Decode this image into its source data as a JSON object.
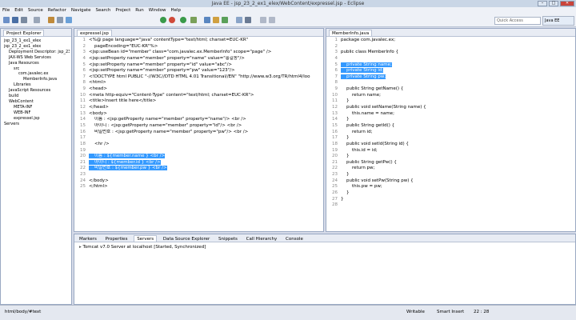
{
  "window": {
    "title": "Java EE - jsp_23_2_ex1_elex/WebContent/expressel.jsp - Eclipse"
  },
  "menu": [
    "File",
    "Edit",
    "Source",
    "Refactor",
    "Navigate",
    "Search",
    "Project",
    "Run",
    "Window",
    "Help"
  ],
  "toolbar": {
    "quick_access": "Quick Access",
    "perspective": "Java EE"
  },
  "project_explorer": {
    "tab": "Project Explorer",
    "items": [
      "jsp_23_1_ex1_elex",
      "jsp_23_2_ex1_elex",
      "Deployment Descriptor: jsp_23",
      "JAX-WS Web Services",
      "Java Resources",
      "src",
      "com.javalec.ex",
      "MemberInfo.java",
      "Libraries",
      "JavaScript Resources",
      "build",
      "WebContent",
      "META-INF",
      "WEB-INF",
      "expressel.jsp",
      "Servers"
    ]
  },
  "editor_left": {
    "tab": "expressel.jsp",
    "lines": [
      "<%@ page language=\"java\" contentType=\"text/html; charset=EUC-KR\"",
      "    pageEncoding=\"EUC-KR\"%>",
      "<jsp:useBean id=\"member\" class=\"com.javalec.ex.MemberInfo\" scope=\"page\" />",
      "<jsp:setProperty name=\"member\" property=\"name\" value=\"홍길동\"/>",
      "<jsp:setProperty name=\"member\" property=\"id\" value=\"abc\"/>",
      "<jsp:setProperty name=\"member\" property=\"pw\" value=\"123\"/>",
      "<!DOCTYPE html PUBLIC \"-//W3C//DTD HTML 4.01 Transitional//EN\" \"http://www.w3.org/TR/html4/loo",
      "<html>",
      "<head>",
      "<meta http-equiv=\"Content-Type\" content=\"text/html; charset=EUC-KR\">",
      "<title>Insert title here</title>",
      "</head>",
      "<body>",
      "    이름 : <jsp:getProperty name=\"member\" property=\"name\"/> <br />",
      "    아이디 : <jsp:getProperty name=\"member\" property=\"id\"/> <br />",
      "    비밀번호 : <jsp:getProperty name=\"member\" property=\"pw\"/> <br />",
      "",
      "    <hr />",
      "",
      "    이름 : ${member.name } <br />",
      "    아이디 : ${member.id } <br />",
      "    비밀번호 : ${member.pw } <br />",
      "",
      "</body>",
      "</html>"
    ],
    "selected_lines": [
      20,
      21,
      22
    ]
  },
  "editor_right": {
    "tab": "MemberInfo.java",
    "lines": [
      "package com.javalec.ex;",
      "",
      "public class MemberInfo {",
      "",
      "    private String name;",
      "    private String id;",
      "    private String pw;",
      "",
      "    public String getName() {",
      "        return name;",
      "    }",
      "    public void setName(String name) {",
      "        this.name = name;",
      "    }",
      "    public String getId() {",
      "        return id;",
      "    }",
      "    public void setId(String id) {",
      "        this.id = id;",
      "    }",
      "    public String getPw() {",
      "        return pw;",
      "    }",
      "    public void setPw(String pw) {",
      "        this.pw = pw;",
      "    }",
      "}",
      ""
    ],
    "selected_lines": [
      5,
      6,
      7
    ]
  },
  "bottom_panel": {
    "tabs": [
      "Markers",
      "Properties",
      "Servers",
      "Data Source Explorer",
      "Snippets",
      "Call Hierarchy",
      "Console"
    ],
    "server_entry": "Tomcat v7.0 Server at localhost  [Started, Synchronized]"
  },
  "status": {
    "path": "html/body/#text",
    "writable": "Writable",
    "insert_mode": "Smart Insert",
    "position": "22 : 28"
  },
  "colors": {
    "selection": "#3399ff",
    "keyword": "#7f0055",
    "string": "#2a00ff"
  }
}
